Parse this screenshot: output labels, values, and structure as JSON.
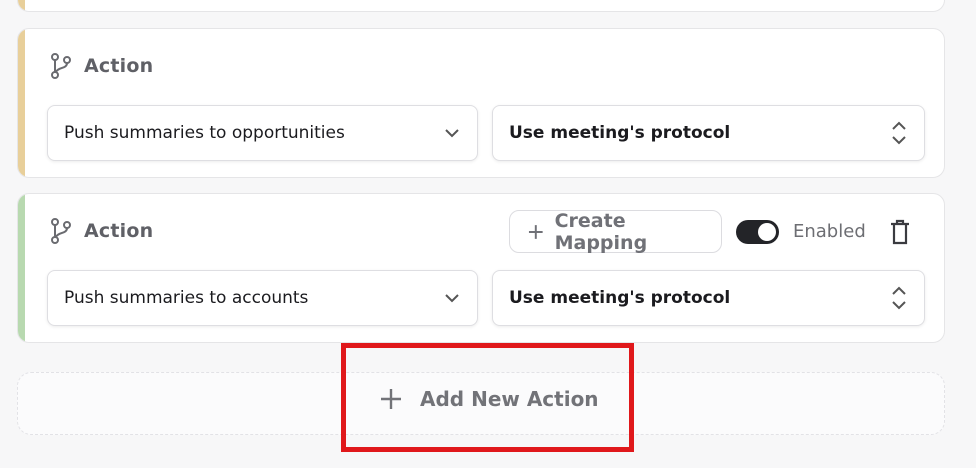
{
  "colors": {
    "stripe_first": "#e8cf9a",
    "stripe_second": "#b8d9b0",
    "highlight": "#e0181b"
  },
  "actions": [
    {
      "title": "Action",
      "trigger_value": "Push summaries to opportunities",
      "protocol_value": "Use meeting's protocol"
    },
    {
      "title": "Action",
      "trigger_value": "Push summaries to accounts",
      "protocol_value": "Use meeting's protocol",
      "create_mapping_label": "Create Mapping",
      "toggle_on": true,
      "enabled_label": "Enabled"
    }
  ],
  "add_action_label": "Add New Action",
  "icons": {
    "branch": "branch-icon",
    "chevron": "chevron-down-icon",
    "updown": "updown-chevron-icon",
    "plus": "plus-icon",
    "trash": "trash-icon"
  }
}
